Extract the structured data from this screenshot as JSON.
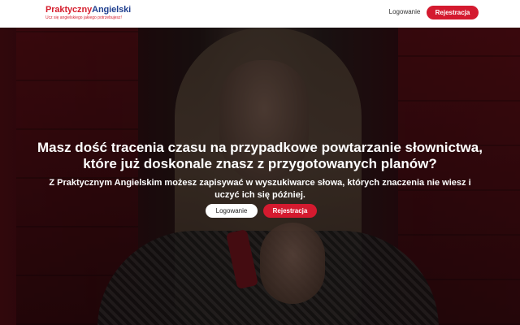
{
  "header": {
    "logo": {
      "part1": "Praktyczny",
      "part2": "Angielski",
      "tagline": "Ucz się angielskiego jakiego potrzebujesz!"
    },
    "login_label": "Logowanie",
    "register_label": "Rejestracja"
  },
  "hero": {
    "headline": "Masz dość tracenia czasu na przypadkowe powtarzanie słownictwa, które już doskonale znasz z przygotowanych planów?",
    "subtext": "Z Praktycznym Angielskim możesz zapisywać w wyszukiwarce słowa, których znaczenia nie wiesz i uczyć ich się później.",
    "login_label": "Logowanie",
    "register_label": "Rejestracja"
  },
  "colors": {
    "brand_red": "#d41a2f",
    "brand_blue": "#1f3f8f",
    "header_bg": "#ffffff",
    "overlay": "rgba(0,0,0,0.45)"
  }
}
